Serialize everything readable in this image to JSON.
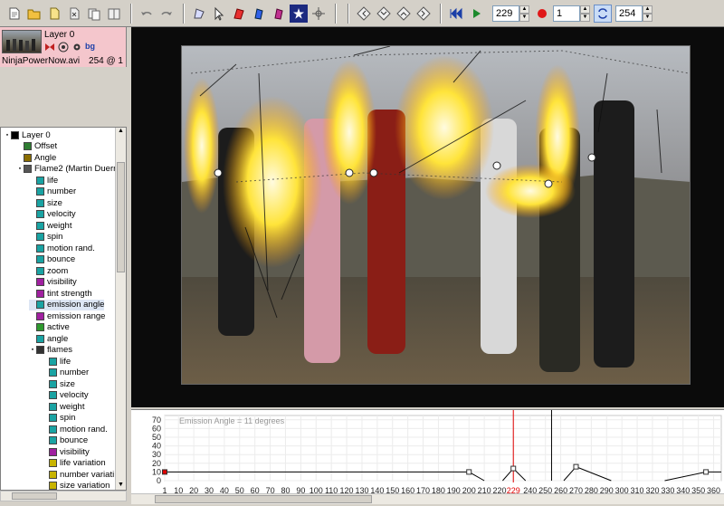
{
  "toolbar": {
    "tool_icons": [
      "new-layer-icon",
      "open-folder-icon",
      "file-icon",
      "file-x-icon",
      "copy-file-icon",
      "book-icon",
      "undo-icon",
      "redo-icon",
      "polygon-icon",
      "select-arrow-icon",
      "red-shape-icon",
      "blue-shape-icon",
      "magenta-shape-icon",
      "star-generator-icon",
      "crosshair-icon"
    ],
    "nav_icons": [
      "nav-prev-icon",
      "nav-down-icon",
      "nav-up-icon",
      "nav-next-icon"
    ],
    "current_frame": "229",
    "step": "1",
    "end_frame": "254"
  },
  "layer": {
    "name": "Layer 0",
    "file": "NinjaPowerNow.avi",
    "frames": "254 @ 1",
    "badge": "bg"
  },
  "tree": {
    "items": [
      {
        "label": "Layer 0",
        "depth": 0,
        "expander": "minus",
        "icon_color": "#000000"
      },
      {
        "label": "Offset",
        "depth": 1,
        "expander": "",
        "icon_color": "#2e7d32"
      },
      {
        "label": "Angle",
        "depth": 1,
        "expander": "",
        "icon_color": "#8a6d00"
      },
      {
        "label": "Flame2 (Martin Duerr)",
        "depth": 1,
        "expander": "minus",
        "icon_color": "#555555"
      },
      {
        "label": "life",
        "depth": 2,
        "expander": "",
        "icon_color": "#1aa3a3"
      },
      {
        "label": "number",
        "depth": 2,
        "expander": "",
        "icon_color": "#1aa3a3"
      },
      {
        "label": "size",
        "depth": 2,
        "expander": "",
        "icon_color": "#1aa3a3"
      },
      {
        "label": "velocity",
        "depth": 2,
        "expander": "",
        "icon_color": "#1aa3a3"
      },
      {
        "label": "weight",
        "depth": 2,
        "expander": "",
        "icon_color": "#1aa3a3"
      },
      {
        "label": "spin",
        "depth": 2,
        "expander": "",
        "icon_color": "#1aa3a3"
      },
      {
        "label": "motion rand.",
        "depth": 2,
        "expander": "",
        "icon_color": "#1aa3a3"
      },
      {
        "label": "bounce",
        "depth": 2,
        "expander": "",
        "icon_color": "#1aa3a3"
      },
      {
        "label": "zoom",
        "depth": 2,
        "expander": "",
        "icon_color": "#1aa3a3"
      },
      {
        "label": "visibility",
        "depth": 2,
        "expander": "",
        "icon_color": "#a020a0"
      },
      {
        "label": "tint strength",
        "depth": 2,
        "expander": "",
        "icon_color": "#a020a0"
      },
      {
        "label": "emission angle",
        "depth": 2,
        "expander": "",
        "icon_color": "#1aa3a3",
        "highlight": true
      },
      {
        "label": "emission range",
        "depth": 2,
        "expander": "",
        "icon_color": "#a020a0"
      },
      {
        "label": "active",
        "depth": 2,
        "expander": "",
        "icon_color": "#2e9a2e"
      },
      {
        "label": "angle",
        "depth": 2,
        "expander": "",
        "icon_color": "#1aa3a3"
      },
      {
        "label": "flames",
        "depth": 2,
        "expander": "minus",
        "icon_color": "#333333"
      },
      {
        "label": "life",
        "depth": 3,
        "expander": "",
        "icon_color": "#1aa3a3"
      },
      {
        "label": "number",
        "depth": 3,
        "expander": "",
        "icon_color": "#1aa3a3"
      },
      {
        "label": "size",
        "depth": 3,
        "expander": "",
        "icon_color": "#1aa3a3"
      },
      {
        "label": "velocity",
        "depth": 3,
        "expander": "",
        "icon_color": "#1aa3a3"
      },
      {
        "label": "weight",
        "depth": 3,
        "expander": "",
        "icon_color": "#1aa3a3"
      },
      {
        "label": "spin",
        "depth": 3,
        "expander": "",
        "icon_color": "#1aa3a3"
      },
      {
        "label": "motion rand.",
        "depth": 3,
        "expander": "",
        "icon_color": "#1aa3a3"
      },
      {
        "label": "bounce",
        "depth": 3,
        "expander": "",
        "icon_color": "#1aa3a3"
      },
      {
        "label": "visibility",
        "depth": 3,
        "expander": "",
        "icon_color": "#a020a0"
      },
      {
        "label": "life variation",
        "depth": 3,
        "expander": "",
        "icon_color": "#c8b400"
      },
      {
        "label": "number variati",
        "depth": 3,
        "expander": "",
        "icon_color": "#c8b400"
      },
      {
        "label": "size variation",
        "depth": 3,
        "expander": "",
        "icon_color": "#c8b400"
      }
    ]
  },
  "graph": {
    "label": "Emission Angle = 11 degrees",
    "y_ticks": [
      "70",
      "60",
      "50",
      "40",
      "30",
      "20",
      "10",
      "0"
    ],
    "x_ticks": [
      "1",
      "10",
      "20",
      "30",
      "40",
      "50",
      "60",
      "70",
      "80",
      "90",
      "100",
      "110",
      "120",
      "130",
      "140",
      "150",
      "160",
      "170",
      "180",
      "190",
      "200",
      "210",
      "220",
      "229",
      "240",
      "250",
      "260",
      "270",
      "280",
      "290",
      "300",
      "310",
      "320",
      "330",
      "340",
      "350",
      "360"
    ],
    "current_frame": 229,
    "end_frame": 254,
    "xlim": [
      1,
      365
    ],
    "ylim": [
      0,
      75
    ],
    "keys": [
      [
        1,
        10
      ],
      [
        200,
        10
      ],
      [
        229,
        14
      ],
      [
        270,
        16
      ],
      [
        355,
        10
      ]
    ],
    "segments": [
      [
        [
          1,
          10
        ],
        [
          200,
          10
        ],
        [
          210,
          0
        ]
      ],
      [
        [
          222,
          0
        ],
        [
          229,
          14
        ],
        [
          237,
          0
        ]
      ],
      [
        [
          262,
          0
        ],
        [
          270,
          16
        ],
        [
          293,
          0
        ]
      ],
      [
        [
          328,
          0
        ],
        [
          355,
          10
        ],
        [
          365,
          10
        ]
      ]
    ],
    "colors": {
      "current": "#e00000",
      "end": "#000000",
      "curve": "#000000",
      "key_first": "#e00000"
    }
  }
}
